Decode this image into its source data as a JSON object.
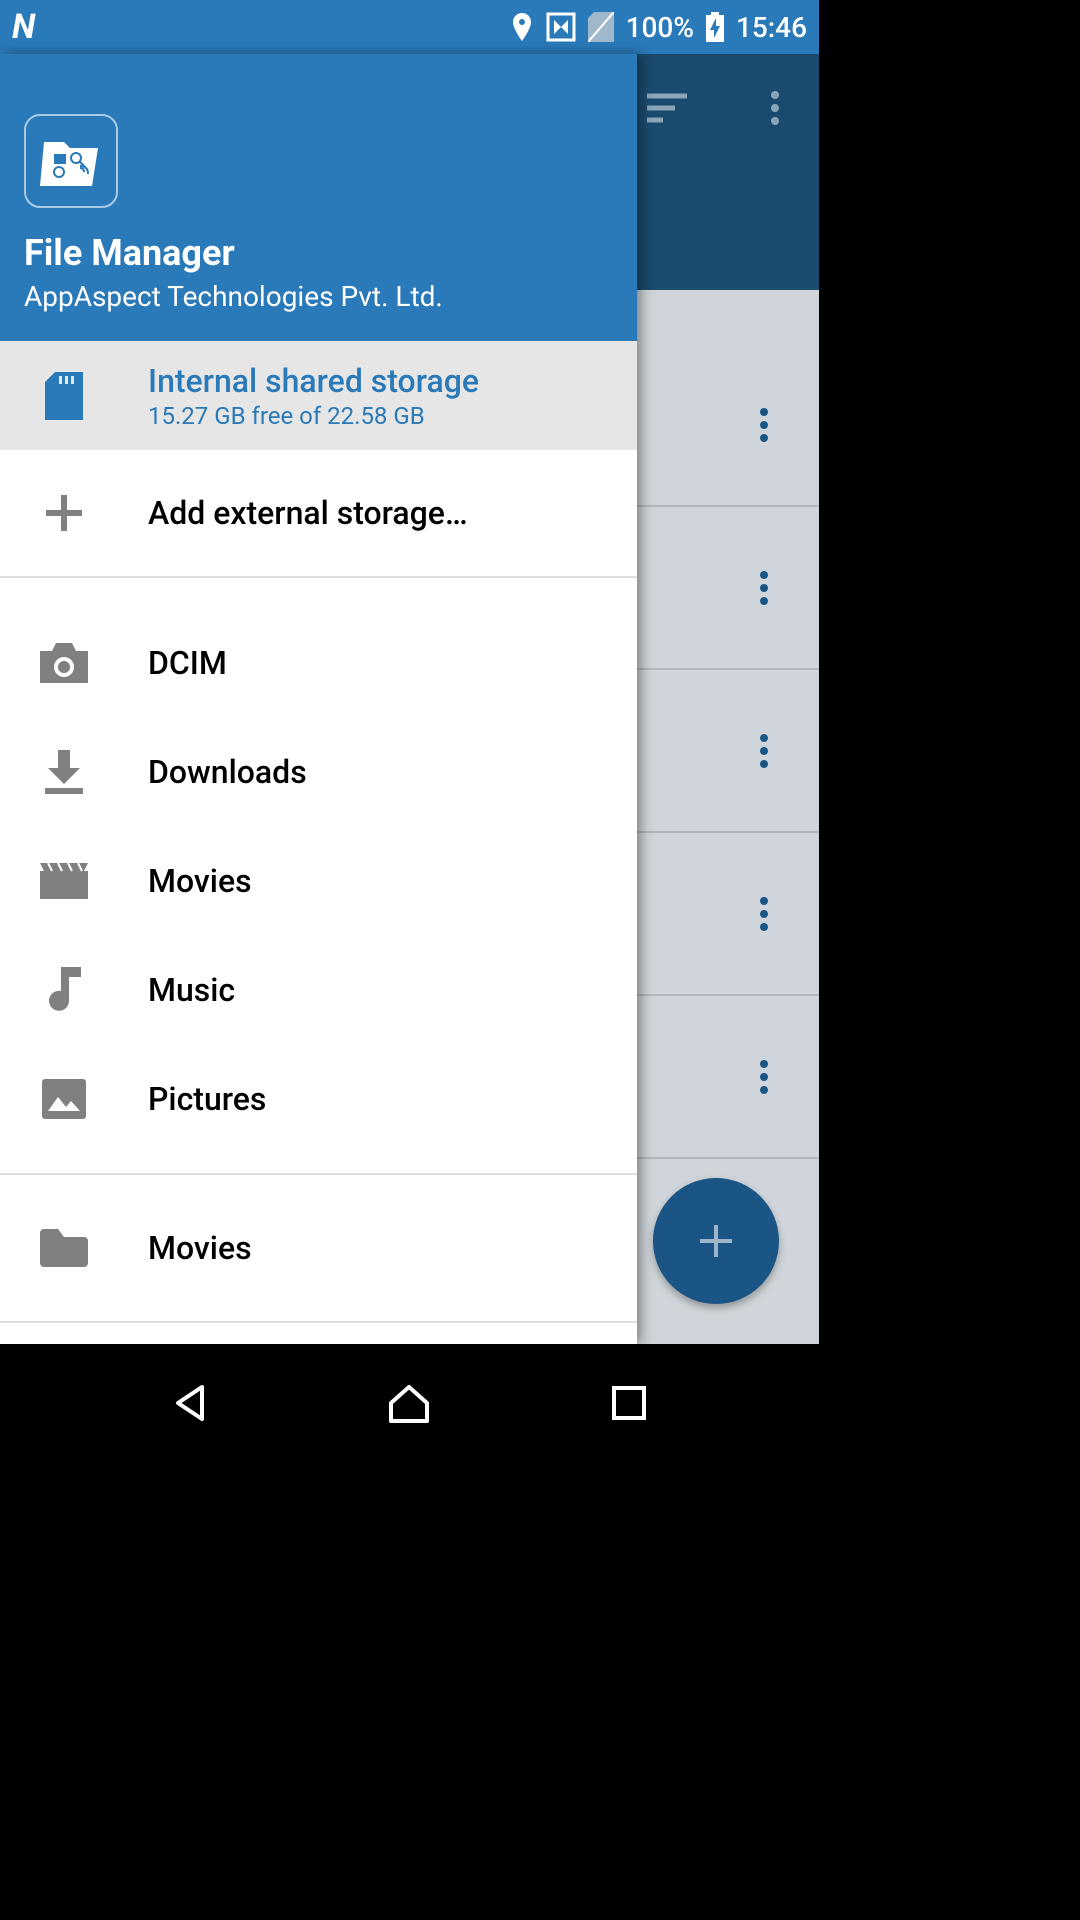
{
  "status": {
    "battery_text": "100%",
    "time": "15:46"
  },
  "drawer": {
    "app_title": "File Manager",
    "app_subtitle": "AppAspect Technologies Pvt. Ltd.",
    "storage": {
      "label": "Internal shared storage",
      "sublabel": "15.27 GB free of 22.58 GB"
    },
    "add_external": "Add external storage…",
    "shortcuts": {
      "dcim": "DCIM",
      "downloads": "Downloads",
      "movies": "Movies",
      "music": "Music",
      "pictures": "Pictures"
    },
    "folder_movies": "Movies"
  },
  "colors": {
    "primary": "#2a7ab9",
    "primary_dark": "#1a4a6e",
    "fab": "#1a5585",
    "icon_gray": "#808080"
  }
}
